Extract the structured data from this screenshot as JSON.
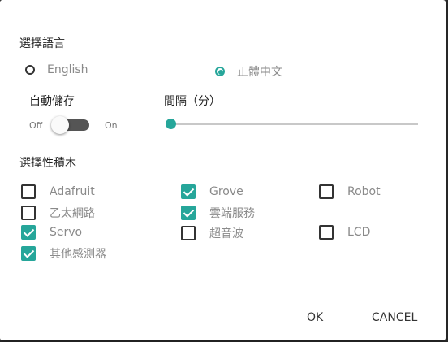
{
  "language": {
    "title": "選擇語言",
    "options": [
      {
        "label": "English",
        "selected": false
      },
      {
        "label": "正體中文",
        "selected": true
      }
    ]
  },
  "autosave": {
    "title": "自動儲存",
    "off_label": "Off",
    "on_label": "On",
    "enabled": false
  },
  "interval": {
    "title": "間隔（分）",
    "value_fraction": 0.0
  },
  "blocks": {
    "title": "選擇性積木",
    "items": [
      {
        "label": "Adafruit",
        "checked": false
      },
      {
        "label": "乙太網路",
        "checked": false
      },
      {
        "label": "Servo",
        "checked": true
      },
      {
        "label": "其他感測器",
        "checked": true
      },
      {
        "label": "Grove",
        "checked": true
      },
      {
        "label": "雲端服務",
        "checked": true
      },
      {
        "label": "超音波",
        "checked": false
      },
      {
        "label": "Robot",
        "checked": false
      },
      {
        "label": "LCD",
        "checked": false
      }
    ]
  },
  "buttons": {
    "ok": "OK",
    "cancel": "CANCEL"
  },
  "colors": {
    "accent": "#26a69a",
    "track_off": "#555555",
    "label_gray": "#8a8a8a"
  }
}
